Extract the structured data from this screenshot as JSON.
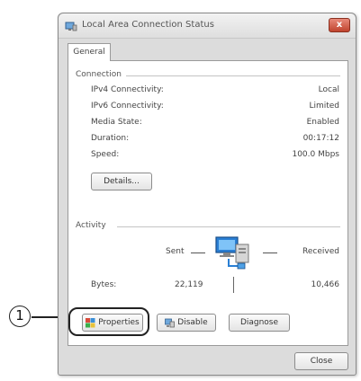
{
  "window": {
    "title": "Local Area Connection Status",
    "close_glyph": "x",
    "tab": "General"
  },
  "connection": {
    "group_label": "Connection",
    "rows": [
      {
        "label": "IPv4 Connectivity:",
        "value": "Local"
      },
      {
        "label": "IPv6 Connectivity:",
        "value": "Limited"
      },
      {
        "label": "Media State:",
        "value": "Enabled"
      },
      {
        "label": "Duration:",
        "value": "00:17:12"
      },
      {
        "label": "Speed:",
        "value": "100.0 Mbps"
      }
    ],
    "details_button": "Details..."
  },
  "activity": {
    "group_label": "Activity",
    "sent_label": "Sent",
    "received_label": "Received",
    "bytes_label": "Bytes:",
    "bytes_sent": "22,119",
    "bytes_received": "10,466"
  },
  "buttons": {
    "properties": "Properties",
    "disable": "Disable",
    "diagnose": "Diagnose",
    "close": "Close"
  },
  "callout": {
    "number": "1"
  },
  "icons": {
    "title": "network-adapter-icon",
    "activity": "network-computers-icon",
    "properties": "shield-icon",
    "disable": "disable-network-icon"
  },
  "colors": {
    "close_button": "#c0442e",
    "highlight_ring": "#222222",
    "monitor_blue": "#2a7fd4"
  }
}
